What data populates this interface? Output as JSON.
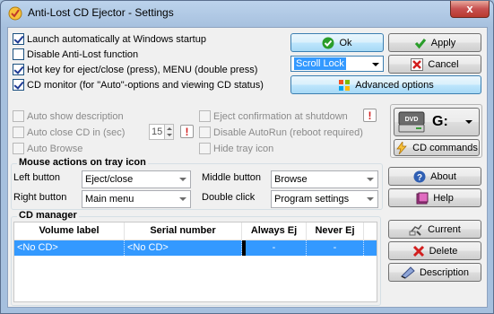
{
  "window": {
    "title": "Anti-Lost CD Ejector - Settings",
    "close_glyph": "x"
  },
  "options": [
    {
      "label": "Launch automatically at Windows startup",
      "checked": true
    },
    {
      "label": "Disable Anti-Lost function",
      "checked": false
    },
    {
      "label": "Hot key for eject/close (press), MENU (double press)",
      "checked": true
    },
    {
      "label": "CD monitor (for \"Auto\"-options and viewing CD status)",
      "checked": true
    }
  ],
  "hotkey": {
    "value": "Scroll Lock"
  },
  "buttons": {
    "ok": "Ok",
    "apply": "Apply",
    "cancel": "Cancel",
    "advanced": "Advanced options",
    "cd_commands": "CD commands",
    "about": "About",
    "help": "Help",
    "current": "Current",
    "delete": "Delete",
    "description": "Description"
  },
  "auto_options": {
    "show_description": "Auto show description",
    "close_cd": "Auto close CD in (sec)",
    "close_cd_seconds": "15",
    "browse": "Auto Browse",
    "eject_confirm": "Eject confirmation at shutdown",
    "disable_autorun": "Disable AutoRun (reboot required)",
    "hide_tray": "Hide tray icon"
  },
  "drive": {
    "letter": "G:",
    "icon_label": "DVD"
  },
  "mouse_actions": {
    "title": "Mouse actions on tray icon",
    "left_label": "Left button",
    "left_value": "Eject/close",
    "right_label": "Right button",
    "right_value": "Main menu",
    "middle_label": "Middle button",
    "middle_value": "Browse",
    "double_label": "Double click",
    "double_value": "Program settings"
  },
  "cd_manager": {
    "title": "CD manager",
    "columns": [
      "Volume label",
      "Serial number",
      "Always Ej",
      "Never Ej"
    ],
    "rows": [
      {
        "volume": "<No CD>",
        "serial": "<No CD>",
        "always": "-",
        "never": "-"
      }
    ]
  },
  "colors": {
    "selection": "#3399ff",
    "ok_green": "#2a9d2a",
    "cancel_red": "#d21f1f",
    "title_bg": "#a6c0de"
  },
  "icons": [
    "app-icon",
    "check-icon",
    "cancel-icon",
    "advanced-icon",
    "dvd-drive-icon",
    "cd-commands-icon",
    "about-icon",
    "help-icon",
    "current-icon",
    "delete-icon",
    "description-icon",
    "info-icon"
  ]
}
